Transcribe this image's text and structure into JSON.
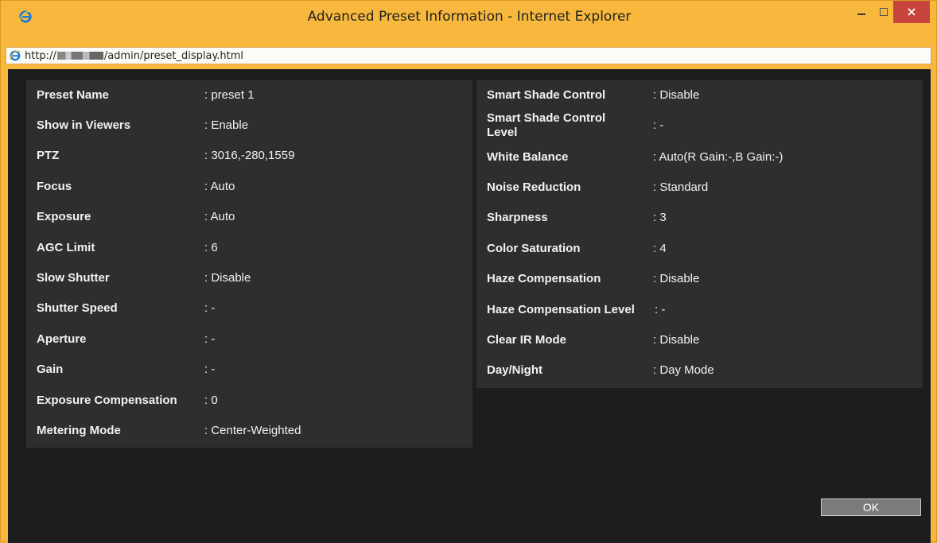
{
  "window": {
    "title": "Advanced Preset Information - Internet Explorer",
    "minimize_label": "–",
    "maximize_label": "□",
    "close_label": "✕"
  },
  "address": {
    "prefix": "http://",
    "suffix": "/admin/preset_display.html"
  },
  "left_panel": {
    "rows": [
      {
        "label": "Preset Name",
        "value": ": preset 1"
      },
      {
        "label": "Show in Viewers",
        "value": ": Enable"
      },
      {
        "label": "PTZ",
        "value": ": 3016,-280,1559"
      },
      {
        "label": "Focus",
        "value": ": Auto"
      },
      {
        "label": "Exposure",
        "value": ": Auto"
      },
      {
        "label": "AGC Limit",
        "value": ": 6"
      },
      {
        "label": "Slow Shutter",
        "value": ": Disable"
      },
      {
        "label": "Shutter Speed",
        "value": ": -"
      },
      {
        "label": "Aperture",
        "value": ": -"
      },
      {
        "label": "Gain",
        "value": ": -"
      },
      {
        "label": "Exposure Compensation",
        "value": ": 0"
      },
      {
        "label": "Metering Mode",
        "value": ": Center-Weighted"
      }
    ]
  },
  "right_panel": {
    "rows": [
      {
        "label": "Smart Shade Control",
        "value": ": Disable"
      },
      {
        "label": "Smart Shade Control Level",
        "value": ": -"
      },
      {
        "label": "White Balance",
        "value": ": Auto(R Gain:-,B Gain:-)"
      },
      {
        "label": "Noise Reduction",
        "value": ": Standard"
      },
      {
        "label": "Sharpness",
        "value": ": 3"
      },
      {
        "label": "Color Saturation",
        "value": ": 4"
      },
      {
        "label": "Haze Compensation",
        "value": ": Disable"
      },
      {
        "label": "Haze Compensation Level",
        "value": ": -"
      },
      {
        "label": "Clear IR Mode",
        "value": ": Disable"
      },
      {
        "label": "Day/Night",
        "value": ": Day Mode"
      }
    ]
  },
  "ok_label": "OK",
  "colors": {
    "frame": "#f7b83d",
    "content_bg": "#1d1d1d",
    "panel_bg": "#2e2e2e",
    "close_button": "#c7443d"
  }
}
